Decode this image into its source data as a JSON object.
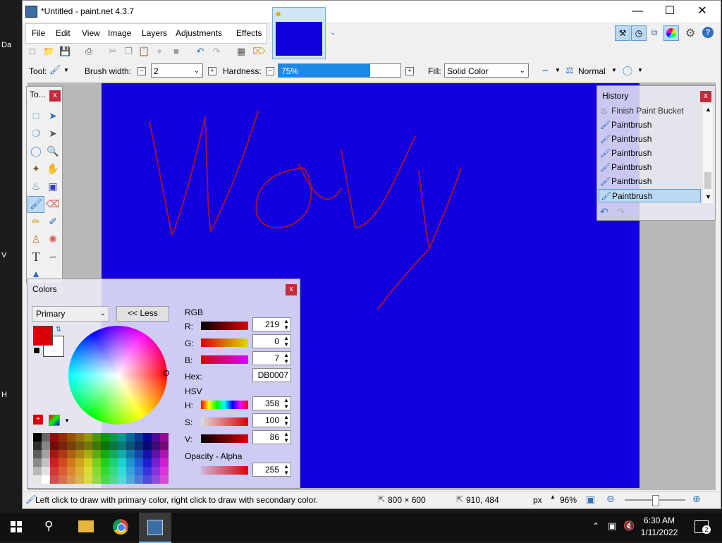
{
  "desktop": {
    "labels": [
      "Da",
      "V",
      "H"
    ]
  },
  "window": {
    "title": "*Untitled - paint.net 4.3.7"
  },
  "menu": [
    "File",
    "Edit",
    "View",
    "Image",
    "Layers",
    "Adjustments",
    "Effects"
  ],
  "toolbar": {
    "tool_label": "Tool:",
    "brush_width_label": "Brush width:",
    "brush_width_value": "2",
    "hardness_label": "Hardness:",
    "hardness_value": "75%",
    "hardness_fraction": 0.75,
    "fill_label": "Fill:",
    "fill_value": "Solid Color",
    "blend_value": "Normal"
  },
  "tools_panel": {
    "title": "To...",
    "close": "x"
  },
  "history": {
    "title": "History",
    "close": "x",
    "items": [
      "Finish Paint Bucket",
      "Paintbrush",
      "Paintbrush",
      "Paintbrush",
      "Paintbrush",
      "Paintbrush",
      "Paintbrush"
    ]
  },
  "colors": {
    "title": "Colors",
    "close": "x",
    "selector": "Primary",
    "less_button": "<< Less",
    "rgb_label": "RGB",
    "r_label": "R:",
    "r_value": "219",
    "g_label": "G:",
    "g_value": "0",
    "b_label": "B:",
    "b_value": "7",
    "hex_label": "Hex:",
    "hex_value": "DB0007",
    "hsv_label": "HSV",
    "h_label": "H:",
    "h_value": "358",
    "s_label": "S:",
    "s_value": "100",
    "v_label": "V:",
    "v_value": "86",
    "opacity_label": "Opacity - Alpha",
    "alpha_value": "255",
    "primary_color": "#db0007",
    "secondary_color": "#ffffff"
  },
  "canvas": {
    "background": "#1100dd",
    "stroke_color": "#a0103a"
  },
  "status": {
    "hint": "Left click to draw with primary color, right click to draw with secondary color.",
    "size": "800 × 600",
    "position": "910, 484",
    "unit": "px",
    "zoom": "96%"
  },
  "taskbar": {
    "time": "6:30 AM",
    "date": "1/11/2022",
    "notif_count": "2"
  }
}
